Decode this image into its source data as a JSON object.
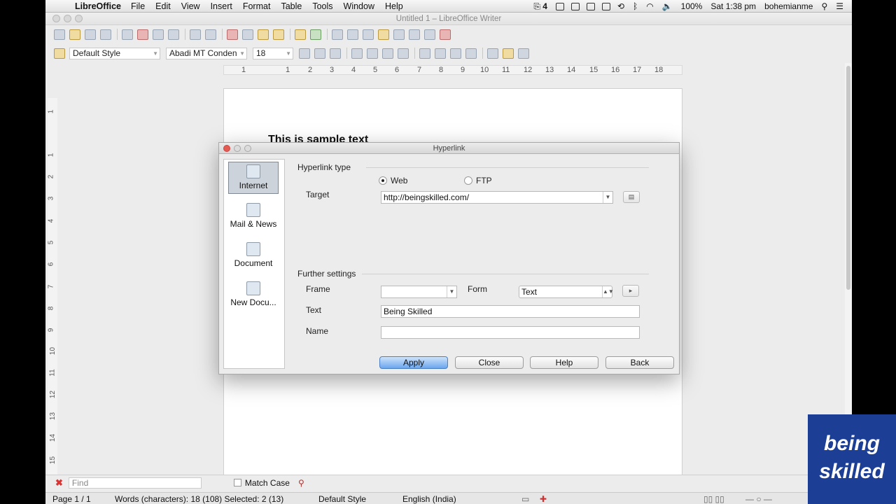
{
  "menubar": {
    "app_name": "LibreOffice",
    "items": [
      "File",
      "Edit",
      "View",
      "Insert",
      "Format",
      "Table",
      "Tools",
      "Window",
      "Help"
    ],
    "battery": "100%",
    "clock": "Sat 1:38 pm",
    "user": "bohemianme",
    "adobe_badge": "4"
  },
  "window": {
    "title": "Untitled 1 – LibreOffice Writer"
  },
  "formatting": {
    "paragraph_style": "Default Style",
    "font_name": "Abadi MT Conden",
    "font_size": "18"
  },
  "ruler": {
    "ticks": [
      "1",
      "1",
      "2",
      "3",
      "4",
      "5",
      "6",
      "7",
      "8",
      "9",
      "10",
      "11",
      "12",
      "13",
      "14",
      "15",
      "16",
      "17",
      "18"
    ]
  },
  "vertical_ruler": {
    "ticks": [
      "1",
      "1",
      "2",
      "3",
      "4",
      "5",
      "6",
      "7",
      "8",
      "9",
      "10",
      "11",
      "12",
      "13",
      "14",
      "15"
    ]
  },
  "document": {
    "text": "This is sample text"
  },
  "dialog": {
    "title": "Hyperlink",
    "categories": [
      {
        "label": "Internet",
        "selected": true
      },
      {
        "label": "Mail & News",
        "selected": false
      },
      {
        "label": "Document",
        "selected": false
      },
      {
        "label": "New Docu...",
        "selected": false
      }
    ],
    "hyperlink_type_label": "Hyperlink type",
    "radio_web": "Web",
    "radio_ftp": "FTP",
    "selected_type": "Web",
    "target_label": "Target",
    "target_value": "http://beingskilled.com/",
    "further_settings_label": "Further settings",
    "frame_label": "Frame",
    "frame_value": "",
    "form_label": "Form",
    "form_value": "Text",
    "text_label": "Text",
    "text_value": "Being Skilled",
    "name_label": "Name",
    "name_value": "",
    "buttons": {
      "apply": "Apply",
      "close": "Close",
      "help": "Help",
      "back": "Back"
    }
  },
  "findbar": {
    "placeholder": "Find",
    "match_case": "Match Case"
  },
  "statusbar": {
    "page": "Page 1 / 1",
    "words": "Words (characters): 18 (108) Selected: 2 (13)",
    "style": "Default Style",
    "language": "English (India)"
  },
  "watermark": {
    "line1": "being",
    "line2": "skilled"
  }
}
